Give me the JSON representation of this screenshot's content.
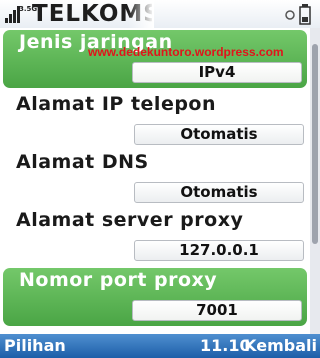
{
  "statusbar": {
    "operator": "TELKOMSEL",
    "network_indicator": "3.5G",
    "signal_icon": "signal-bars-icon",
    "battery_icon": "battery-icon"
  },
  "watermark": "www.dedekuntoro.wordpress.com",
  "settings": [
    {
      "label": "Jenis jaringan",
      "value": "IPv4",
      "selected": true
    },
    {
      "label": "Alamat IP telepon",
      "value": "Otomatis"
    },
    {
      "label": "Alamat DNS",
      "value": "Otomatis"
    },
    {
      "label": "Alamat server proxy",
      "value": "127.0.0.1"
    },
    {
      "label": "Nomor port proxy",
      "value": "7001",
      "selected": true
    }
  ],
  "softkeys": {
    "left": "Pilihan",
    "time": "11.10",
    "right": "Kembali"
  },
  "colors": {
    "highlight": "#5bb653",
    "softkey_bar": "#2a6fb8",
    "watermark": "#e0141b"
  }
}
